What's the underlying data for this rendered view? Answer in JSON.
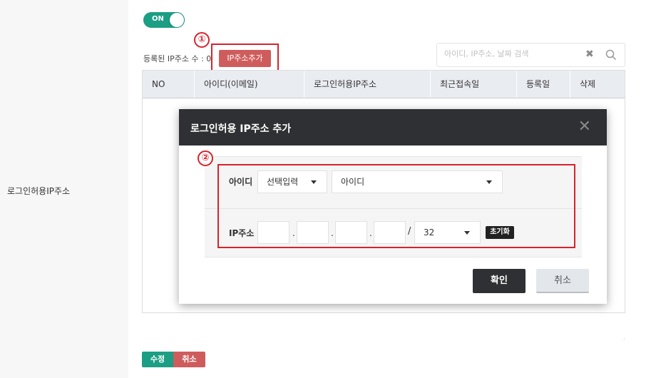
{
  "sidebar": {
    "label": "로그인허용IP주소"
  },
  "toggle": {
    "label": "ON",
    "state": "on",
    "color": "#1b9e83"
  },
  "ip_list": {
    "count_label": "등록된 IP주소 수 : ",
    "count": "0",
    "add_button": "IP주소추가"
  },
  "search": {
    "placeholder": "아이디, IP주소, 날짜 검색",
    "clear_icon": "close-icon",
    "search_icon": "magnifier-icon"
  },
  "table": {
    "columns": [
      "NO",
      "아이디(이메일)",
      "로그인허용IP주소",
      "최근접속일",
      "등록일",
      "삭제"
    ],
    "rows": []
  },
  "annotations": {
    "marker1": "①",
    "marker2": "②",
    "color": "#d8222d"
  },
  "dialog": {
    "title": "로그인허용 IP주소 추가",
    "close_icon": "close-icon",
    "id_label": "아이디",
    "id_mode_select": "선택입력",
    "id_select": "아이디",
    "ip_label": "IP주소",
    "ip_octets": [
      "",
      "",
      "",
      ""
    ],
    "ip_separator": ".",
    "cidr_separator": "/",
    "cidr": "32",
    "reset_button": "초기화",
    "confirm_button": "확인",
    "cancel_button": "취소"
  },
  "footer": {
    "dot": ".",
    "save_button": "수정",
    "cancel_button": "취소"
  },
  "colors": {
    "accent_green": "#1b9e83",
    "accent_red": "#cf5c5c",
    "dark": "#2e3033"
  }
}
